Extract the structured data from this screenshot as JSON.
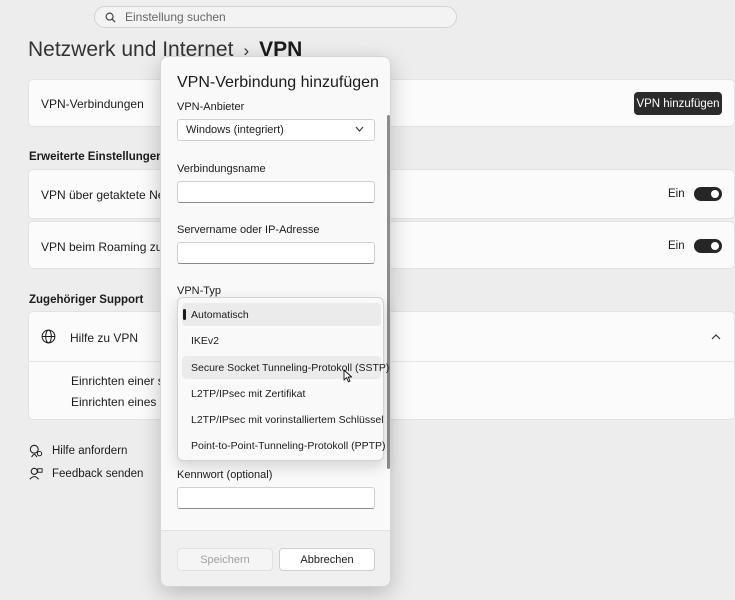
{
  "search": {
    "placeholder": "Einstellung suchen"
  },
  "breadcrumb": {
    "parent": "Netzwerk und Internet",
    "separator": "›",
    "current": "VPN"
  },
  "vpn_connections": {
    "label": "VPN-Verbindungen",
    "add_button": "VPN hinzufügen"
  },
  "advanced": {
    "heading": "Erweiterte Einstellungen für a",
    "metered": {
      "label": "VPN über getaktete Netzwe",
      "state": "Ein"
    },
    "roaming": {
      "label": "VPN beim Roaming zulasse",
      "state": "Ein"
    }
  },
  "support": {
    "heading": "Zugehöriger Support",
    "help_vpn": "Hilfe zu VPN",
    "links": [
      "Einrichten einer sich",
      "Einrichten eines VPN"
    ]
  },
  "bottom_links": {
    "get_help": "Hilfe anfordern",
    "feedback": "Feedback senden"
  },
  "dialog": {
    "title": "VPN-Verbindung hinzufügen",
    "provider_label": "VPN-Anbieter",
    "provider_value": "Windows (integriert)",
    "connection_name_label": "Verbindungsname",
    "server_label": "Servername oder IP-Adresse",
    "vpn_type_label": "VPN-Typ",
    "password_label": "Kennwort (optional)",
    "save_button": "Speichern",
    "cancel_button": "Abbrechen"
  },
  "vpn_type_options": [
    "Automatisch",
    "IKEv2",
    "Secure Socket Tunneling-Protokoll (SSTP)",
    "L2TP/IPsec mit Zertifikat",
    "L2TP/IPsec mit vorinstalliertem Schlüssel",
    "Point-to-Point-Tunneling-Protokoll (PPTP)"
  ],
  "colors": {
    "accent_dark": "#2b2b2b",
    "background": "#ededed",
    "dialog": "#f9f9f9"
  },
  "icons": [
    "search-icon",
    "chevron-down-icon",
    "chevron-up-icon",
    "globe-icon",
    "help-person-icon",
    "feedback-icon",
    "mouse-cursor-icon"
  ]
}
